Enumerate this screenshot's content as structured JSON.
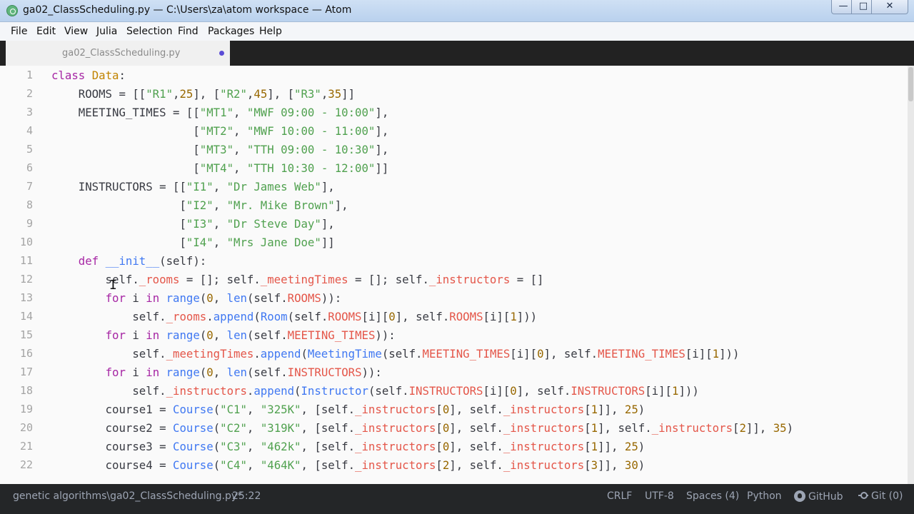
{
  "window": {
    "title": "ga02_ClassScheduling.py — C:\\Users\\za\\atom workspace — Atom",
    "minimize": "—",
    "maximize": "□",
    "close": "✕"
  },
  "menu": [
    "File",
    "Edit",
    "View",
    "Julia",
    "Selection",
    "Find",
    "Packages",
    "Help"
  ],
  "tab": {
    "title": "ga02_ClassScheduling.py",
    "modified_color": "#5b4cd6"
  },
  "editor": {
    "line_numbers": [
      "1",
      "2",
      "3",
      "4",
      "5",
      "6",
      "7",
      "8",
      "9",
      "10",
      "11",
      "12",
      "13",
      "14",
      "15",
      "16",
      "17",
      "18",
      "19",
      "20",
      "21",
      "22"
    ],
    "lines": [
      "class Data:",
      "    ROOMS = [[\"R1\",25], [\"R2\",45], [\"R3\",35]]",
      "    MEETING_TIMES = [[\"MT1\", \"MWF 09:00 - 10:00\"],",
      "                     [\"MT2\", \"MWF 10:00 - 11:00\"],",
      "                     [\"MT3\", \"TTH 09:00 - 10:30\"],",
      "                     [\"MT4\", \"TTH 10:30 - 12:00\"]]",
      "    INSTRUCTORS = [[\"I1\", \"Dr James Web\"],",
      "                   [\"I2\", \"Mr. Mike Brown\"],",
      "                   [\"I3\", \"Dr Steve Day\"],",
      "                   [\"I4\", \"Mrs Jane Doe\"]]",
      "    def __init__(self):",
      "        self._rooms = []; self._meetingTimes = []; self._instructors = []",
      "        for i in range(0, len(self.ROOMS)):",
      "            self._rooms.append(Room(self.ROOMS[i][0], self.ROOMS[i][1]))",
      "        for i in range(0, len(self.MEETING_TIMES)):",
      "            self._meetingTimes.append(MeetingTime(self.MEETING_TIMES[i][0], self.MEETING_TIMES[i][1]))",
      "        for i in range(0, len(self.INSTRUCTORS)):",
      "            self._instructors.append(Instructor(self.INSTRUCTORS[i][0], self.INSTRUCTORS[i][1]))",
      "        course1 = Course(\"C1\", \"325K\", [self._instructors[0], self._instructors[1]], 25)",
      "        course2 = Course(\"C2\", \"319K\", [self._instructors[0], self._instructors[1], self._instructors[2]], 35)",
      "        course3 = Course(\"C3\", \"462k\", [self._instructors[0], self._instructors[1]], 25)",
      "        course4 = Course(\"C4\", \"464K\", [self._instructors[2], self._instructors[3]], 30)"
    ]
  },
  "status": {
    "path": "genetic algorithms\\ga02_ClassScheduling.py*",
    "cursor": "25:22",
    "line_ending": "CRLF",
    "encoding": "UTF-8",
    "indent": "Spaces (4)",
    "grammar": "Python",
    "github": "GitHub",
    "git": "Git (0)"
  }
}
